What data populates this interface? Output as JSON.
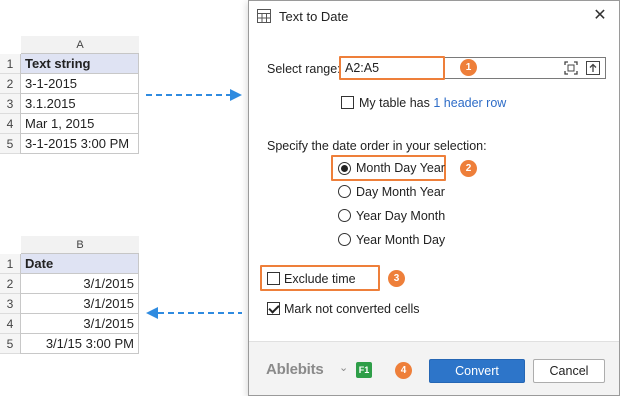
{
  "sheet_top": {
    "column": "A",
    "rows": [
      {
        "n": "1",
        "value": "Text string",
        "header": true
      },
      {
        "n": "2",
        "value": "3-1-2015"
      },
      {
        "n": "3",
        "value": "3.1.2015"
      },
      {
        "n": "4",
        "value": "Mar 1, 2015"
      },
      {
        "n": "5",
        "value": "3-1-2015 3:00 PM"
      }
    ]
  },
  "sheet_bottom": {
    "column": "B",
    "rows": [
      {
        "n": "1",
        "value": "Date",
        "header": true
      },
      {
        "n": "2",
        "value": "3/1/2015"
      },
      {
        "n": "3",
        "value": "3/1/2015"
      },
      {
        "n": "4",
        "value": "3/1/2015"
      },
      {
        "n": "5",
        "value": "3/1/15 3:00 PM"
      }
    ]
  },
  "dialog": {
    "title": "Text to Date",
    "close_icon": "close-icon",
    "select_range_label": "Select range:",
    "range_value": "A2:A5",
    "header_prefix": "My table has",
    "header_link": "1 header row",
    "date_order_label": "Specify the date order in your selection:",
    "date_orders": [
      "Month Day Year",
      "Day Month Year",
      "Year Day Month",
      "Year Month Day"
    ],
    "selected_order": "Month Day Year",
    "exclude_time_label": "Exclude time",
    "exclude_time_checked": false,
    "mark_label": "Mark not converted cells",
    "mark_checked": true,
    "header_row_checked": false,
    "brand": "Ablebits",
    "help_key": "F1",
    "convert_label": "Convert",
    "cancel_label": "Cancel",
    "badges": [
      "1",
      "2",
      "3",
      "4"
    ]
  },
  "colors": {
    "accent_orange": "#ee7f3a",
    "primary_button": "#2d75c9",
    "link": "#2e6cc7",
    "arrow_blue": "#2f8be0",
    "header_cell": "#dfe3f3",
    "help_green": "#2e9e48"
  }
}
